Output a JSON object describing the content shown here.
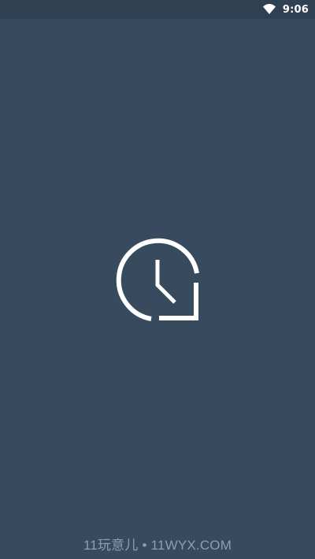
{
  "status_bar": {
    "time": "9:06",
    "icons": [
      "wifi-icon"
    ]
  },
  "splash": {
    "logo_icon": "clock-icon"
  },
  "watermark": {
    "text": "11玩意儿 • 11WYX.COM"
  },
  "colors": {
    "background": "#374a5e",
    "status_bar": "#2f4052",
    "icon": "#ffffff",
    "watermark": "#8f9db0"
  }
}
